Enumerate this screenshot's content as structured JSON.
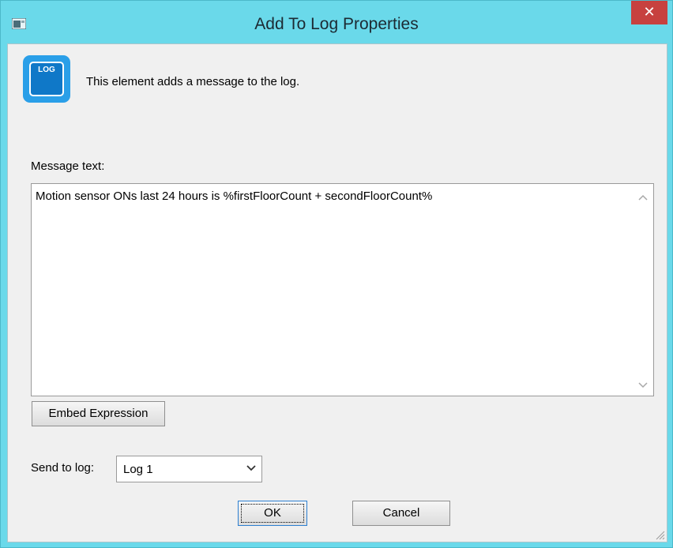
{
  "window": {
    "title": "Add To Log Properties",
    "close_glyph": "✕"
  },
  "header": {
    "icon_text": "LOG",
    "description": "This element adds a message to the log."
  },
  "message": {
    "label": "Message text:",
    "value": "Motion sensor ONs last 24 hours is %firstFloorCount + secondFloorCount%"
  },
  "buttons": {
    "embed": "Embed Expression",
    "ok": "OK",
    "cancel": "Cancel"
  },
  "send_to_log": {
    "label": "Send to log:",
    "selected": "Log 1"
  },
  "icons": {
    "app": "app-window-icon",
    "log": "log-icon",
    "close": "close-icon",
    "dropdown": "chevron-down-icon",
    "grip": "resize-grip-icon"
  },
  "colors": {
    "titlebar": "#6ad9ea",
    "close": "#c7413f",
    "log_icon": "#2a9fe8",
    "ok_border": "#2c7fd1"
  }
}
